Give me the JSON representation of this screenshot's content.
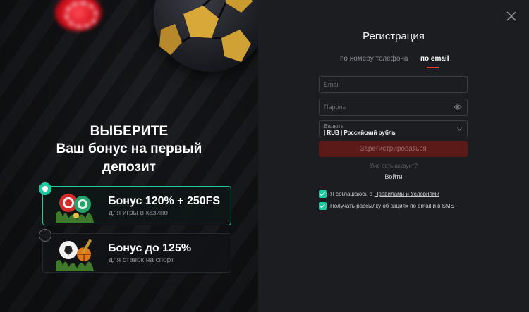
{
  "promo": {
    "title_line1": "ВЫБЕРИТЕ",
    "title_line2": "Ваш бонус на первый",
    "title_line3": "депозит",
    "bonuses": [
      {
        "title": "Бонус 120% + 250FS",
        "subtitle": "для игры в казино",
        "selected": true,
        "icon": "casino-chips-icon"
      },
      {
        "title": "Бонус до 125%",
        "subtitle": "для ставок на спорт",
        "selected": false,
        "icon": "sports-balls-icon"
      }
    ]
  },
  "form": {
    "title": "Регистрация",
    "tabs": [
      {
        "label": "по номеру телефона",
        "active": false
      },
      {
        "label": "по email",
        "active": true
      }
    ],
    "email_placeholder": "Email",
    "password_placeholder": "Пароль",
    "currency_label": "Валюта",
    "currency_value": "| RUB | Российский рубль",
    "submit_label": "Зарегистрироваться",
    "have_account": "Уже есть аккаунт?",
    "login_label": "Войти",
    "agree_text": "Я соглашаюсь с",
    "agree_link": "Правилами и Условиями",
    "newsletter_text": "Получать рассылку об акциях по email и в SMS"
  },
  "colors": {
    "accent_green": "#1ec9a0",
    "accent_red": "#e23a2f",
    "panel_bg": "#1b1d21"
  }
}
